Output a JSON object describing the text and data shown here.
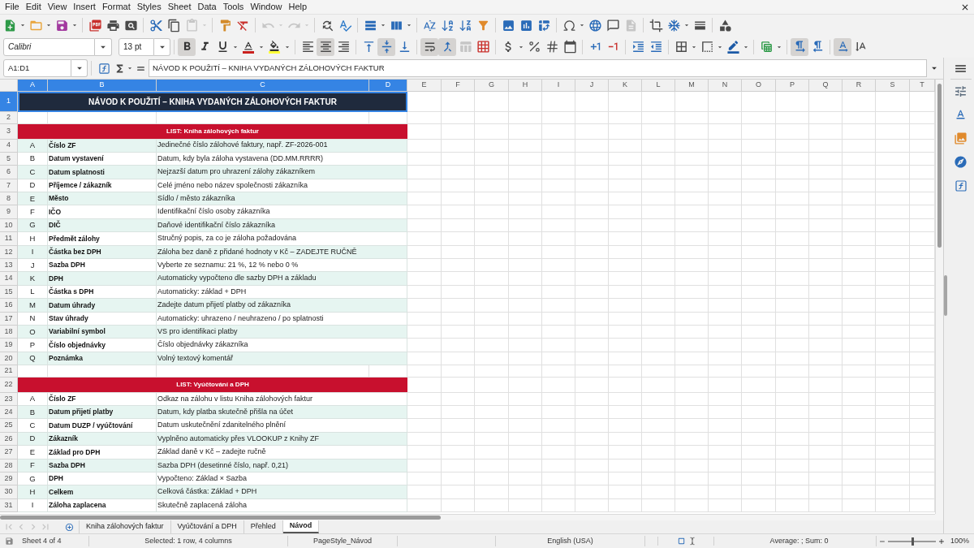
{
  "menu_bar": {
    "items": [
      "File",
      "Edit",
      "View",
      "Insert",
      "Format",
      "Styles",
      "Sheet",
      "Data",
      "Tools",
      "Window",
      "Help"
    ]
  },
  "standard_toolbar": {
    "paste_disabled": true,
    "undo_disabled": true,
    "redo_disabled": true,
    "header_footer_disabled": true
  },
  "formatting_toolbar": {
    "font_name": "Calibri",
    "font_size": "13 pt",
    "bold": true,
    "italic": false,
    "underline": false,
    "align_left": false,
    "align_center": true,
    "align_right": false,
    "align_top": false,
    "align_middle": true,
    "align_bottom": false,
    "wrap_text": true,
    "merge_and_center": true,
    "merge_cells_disabled": true,
    "left_to_right": true,
    "right_to_left": false,
    "text_horizontal": true,
    "text_vertical": false
  },
  "formula_bar": {
    "name_box": "A1:D1",
    "formula": "NÁVOD K POUŽITÍ – KNIHA VYDANÝCH ZÁLOHOVÝCH FAKTUR"
  },
  "sheet": {
    "columns": [
      {
        "label": "A",
        "selected": true
      },
      {
        "label": "B",
        "selected": true
      },
      {
        "label": "C",
        "selected": true
      },
      {
        "label": "D",
        "selected": true
      },
      {
        "label": "E",
        "selected": false
      },
      {
        "label": "F",
        "selected": false
      },
      {
        "label": "G",
        "selected": false
      },
      {
        "label": "H",
        "selected": false
      },
      {
        "label": "I",
        "selected": false
      },
      {
        "label": "J",
        "selected": false
      },
      {
        "label": "K",
        "selected": false
      },
      {
        "label": "L",
        "selected": false
      },
      {
        "label": "M",
        "selected": false
      },
      {
        "label": "N",
        "selected": false
      },
      {
        "label": "O",
        "selected": false
      },
      {
        "label": "P",
        "selected": false
      },
      {
        "label": "Q",
        "selected": false
      },
      {
        "label": "R",
        "selected": false
      },
      {
        "label": "S",
        "selected": false
      },
      {
        "label": "T",
        "selected": false
      }
    ],
    "rows": [
      {
        "number": "1",
        "selected": true,
        "kind": "title",
        "text": "NÁVOD K POUŽITÍ – KNIHA VYDANÝCH ZÁLOHOVÝCH FAKTUR"
      },
      {
        "number": "2",
        "selected": false,
        "kind": "blank"
      },
      {
        "number": "3",
        "selected": false,
        "kind": "section",
        "text": "LIST: Kniha zálohových faktur"
      },
      {
        "number": "4",
        "selected": false,
        "kind": "field",
        "shaded": true,
        "letter": "A",
        "name": "Číslo ZF",
        "description": "Jedinečné číslo zálohové faktury, např. ZF-2026-001"
      },
      {
        "number": "5",
        "selected": false,
        "kind": "field",
        "shaded": false,
        "letter": "B",
        "name": "Datum vystavení",
        "description": "Datum, kdy byla záloha vystavena (DD.MM.RRRR)"
      },
      {
        "number": "6",
        "selected": false,
        "kind": "field",
        "shaded": true,
        "letter": "C",
        "name": "Datum splatnosti",
        "description": "Nejzazší datum pro uhrazení zálohy zákazníkem"
      },
      {
        "number": "7",
        "selected": false,
        "kind": "field",
        "shaded": false,
        "letter": "D",
        "name": "Příjemce / zákazník",
        "description": "Celé jméno nebo název společnosti zákazníka"
      },
      {
        "number": "8",
        "selected": false,
        "kind": "field",
        "shaded": true,
        "letter": "E",
        "name": "Město",
        "description": "Sídlo / město zákazníka"
      },
      {
        "number": "9",
        "selected": false,
        "kind": "field",
        "shaded": false,
        "letter": "F",
        "name": "IČO",
        "description": "Identifikační číslo osoby zákazníka"
      },
      {
        "number": "10",
        "selected": false,
        "kind": "field",
        "shaded": true,
        "letter": "G",
        "name": "DIČ",
        "description": "Daňové identifikační číslo zákazníka"
      },
      {
        "number": "11",
        "selected": false,
        "kind": "field",
        "shaded": false,
        "letter": "H",
        "name": "Předmět zálohy",
        "description": "Stručný popis, za co je záloha požadována"
      },
      {
        "number": "12",
        "selected": false,
        "kind": "field",
        "shaded": true,
        "letter": "I",
        "name": "Částka bez DPH",
        "description": "Záloha bez daně z přidané hodnoty v Kč – ZADEJTE RUČNĚ"
      },
      {
        "number": "13",
        "selected": false,
        "kind": "field",
        "shaded": false,
        "letter": "J",
        "name": "Sazba DPH",
        "description": "Vyberte ze seznamu: 21 %, 12 % nebo 0 %"
      },
      {
        "number": "14",
        "selected": false,
        "kind": "field",
        "shaded": true,
        "letter": "K",
        "name": "DPH",
        "description": "Automaticky vypočteno dle sazby DPH a základu"
      },
      {
        "number": "15",
        "selected": false,
        "kind": "field",
        "shaded": false,
        "letter": "L",
        "name": "Částka s DPH",
        "description": "Automaticky: základ + DPH"
      },
      {
        "number": "16",
        "selected": false,
        "kind": "field",
        "shaded": true,
        "letter": "M",
        "name": "Datum úhrady",
        "description": "Zadejte datum přijetí platby od zákazníka"
      },
      {
        "number": "17",
        "selected": false,
        "kind": "field",
        "shaded": false,
        "letter": "N",
        "name": "Stav úhrady",
        "description": "Automaticky: uhrazeno / neuhrazeno / po splatnosti"
      },
      {
        "number": "18",
        "selected": false,
        "kind": "field",
        "shaded": true,
        "letter": "O",
        "name": "Variabilní symbol",
        "description": "VS pro identifikaci platby"
      },
      {
        "number": "19",
        "selected": false,
        "kind": "field",
        "shaded": false,
        "letter": "P",
        "name": "Číslo objednávky",
        "description": "Číslo objednávky zákazníka"
      },
      {
        "number": "20",
        "selected": false,
        "kind": "field",
        "shaded": true,
        "letter": "Q",
        "name": "Poznámka",
        "description": "Volný textový komentář"
      },
      {
        "number": "21",
        "selected": false,
        "kind": "blank"
      },
      {
        "number": "22",
        "selected": false,
        "kind": "section",
        "text": "LIST: Vyúčtování a DPH"
      },
      {
        "number": "23",
        "selected": false,
        "kind": "field",
        "shaded": false,
        "letter": "A",
        "name": "Číslo ZF",
        "description": "Odkaz na zálohu v listu Kniha zálohových faktur"
      },
      {
        "number": "24",
        "selected": false,
        "kind": "field",
        "shaded": true,
        "letter": "B",
        "name": "Datum přijetí platby",
        "description": "Datum, kdy platba skutečně přišla na účet"
      },
      {
        "number": "25",
        "selected": false,
        "kind": "field",
        "shaded": false,
        "letter": "C",
        "name": "Datum DUZP / vyúčtování",
        "description": "Datum uskutečnění zdanitelného plnění"
      },
      {
        "number": "26",
        "selected": false,
        "kind": "field",
        "shaded": true,
        "letter": "D",
        "name": "Zákazník",
        "description": "Vyplněno automaticky přes VLOOKUP z Knihy ZF"
      },
      {
        "number": "27",
        "selected": false,
        "kind": "field",
        "shaded": false,
        "letter": "E",
        "name": "Základ pro DPH",
        "description": "Základ daně v Kč – zadejte ručně"
      },
      {
        "number": "28",
        "selected": false,
        "kind": "field",
        "shaded": true,
        "letter": "F",
        "name": "Sazba DPH",
        "description": "Sazba DPH (desetinné číslo, např. 0,21)"
      },
      {
        "number": "29",
        "selected": false,
        "kind": "field",
        "shaded": false,
        "letter": "G",
        "name": "DPH",
        "description": "Vypočteno: Základ × Sazba"
      },
      {
        "number": "30",
        "selected": false,
        "kind": "field",
        "shaded": true,
        "letter": "H",
        "name": "Celkem",
        "description": "Celková částka: Základ + DPH"
      },
      {
        "number": "31",
        "selected": false,
        "kind": "field",
        "shaded": false,
        "letter": "I",
        "name": "Záloha zaplacena",
        "description": "Skutečně zaplacená záloha"
      }
    ]
  },
  "sheet_tabs": [
    {
      "label": "Kniha zálohových faktur",
      "selected": false
    },
    {
      "label": "Vyúčtování a DPH",
      "selected": false
    },
    {
      "label": "Přehled",
      "selected": false
    },
    {
      "label": "Návod",
      "selected": true
    }
  ],
  "status_bar": {
    "sheet_position": "Sheet 4 of 4",
    "selection": "Selected: 1 row, 4 columns",
    "page_style": "PageStyle_Návod",
    "language": "English (USA)",
    "summary": "Average: ; Sum: 0",
    "zoom": {
      "level": 0.5,
      "reading": "100%"
    }
  }
}
